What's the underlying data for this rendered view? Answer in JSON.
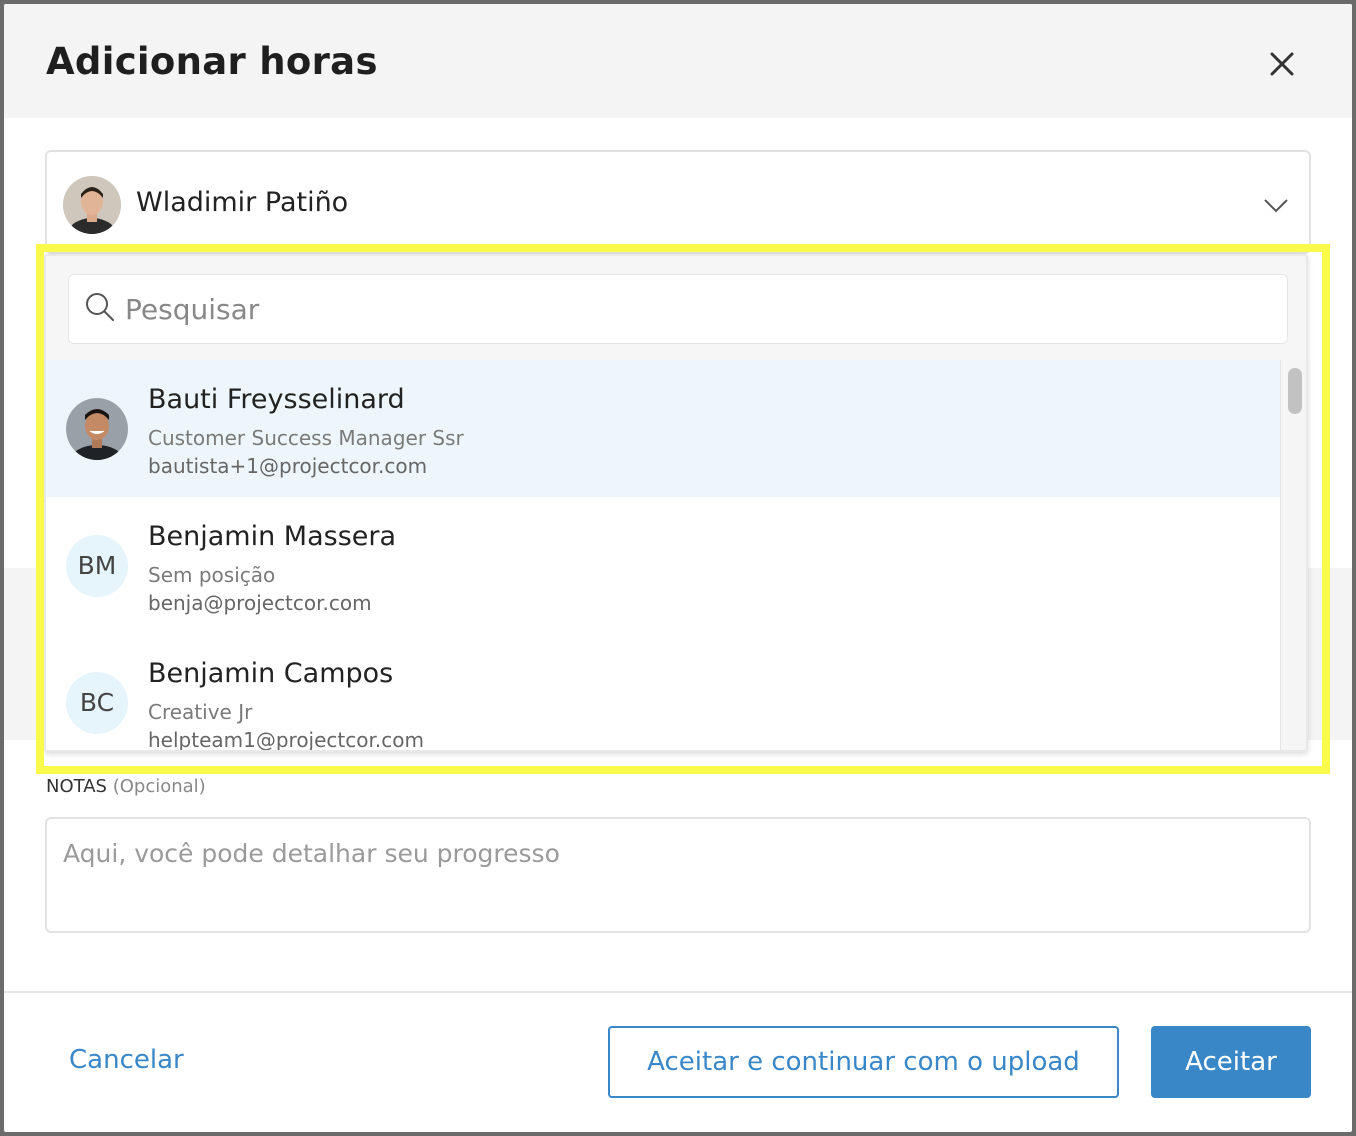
{
  "modal": {
    "title": "Adicionar horas",
    "close_icon": "close-icon"
  },
  "user_select": {
    "selected_name": "Wladimir Patiño",
    "avatar_icon": "avatar",
    "chevron_icon": "chevron-down-icon"
  },
  "dropdown": {
    "search_placeholder": "Pesquisar",
    "search_value": "",
    "search_icon": "search-icon",
    "items": [
      {
        "name": "Bauti Freysselinard",
        "position": "Customer Success Manager Ssr",
        "email": "bautista+1@projectcor.com",
        "initials": "",
        "active": true
      },
      {
        "name": "Benjamin Massera",
        "position": "Sem posição",
        "email": "benja@projectcor.com",
        "initials": "BM",
        "active": false
      },
      {
        "name": "Benjamin Campos",
        "position": "Creative Jr",
        "email": "helpteam1@projectcor.com",
        "initials": "BC",
        "active": false
      }
    ]
  },
  "notes": {
    "label": "NOTAS",
    "optional": "(Opcional)",
    "placeholder": "Aqui, você pode detalhar seu progresso",
    "value": ""
  },
  "footer": {
    "cancel_label": "Cancelar",
    "accept_upload_label": "Aceitar e continuar com o upload",
    "accept_label": "Aceitar"
  },
  "colors": {
    "accent": "#3a87c8",
    "highlight": "#fafa4a",
    "active_row": "#eef6fb",
    "initials_bg": "#e6f4fc"
  }
}
